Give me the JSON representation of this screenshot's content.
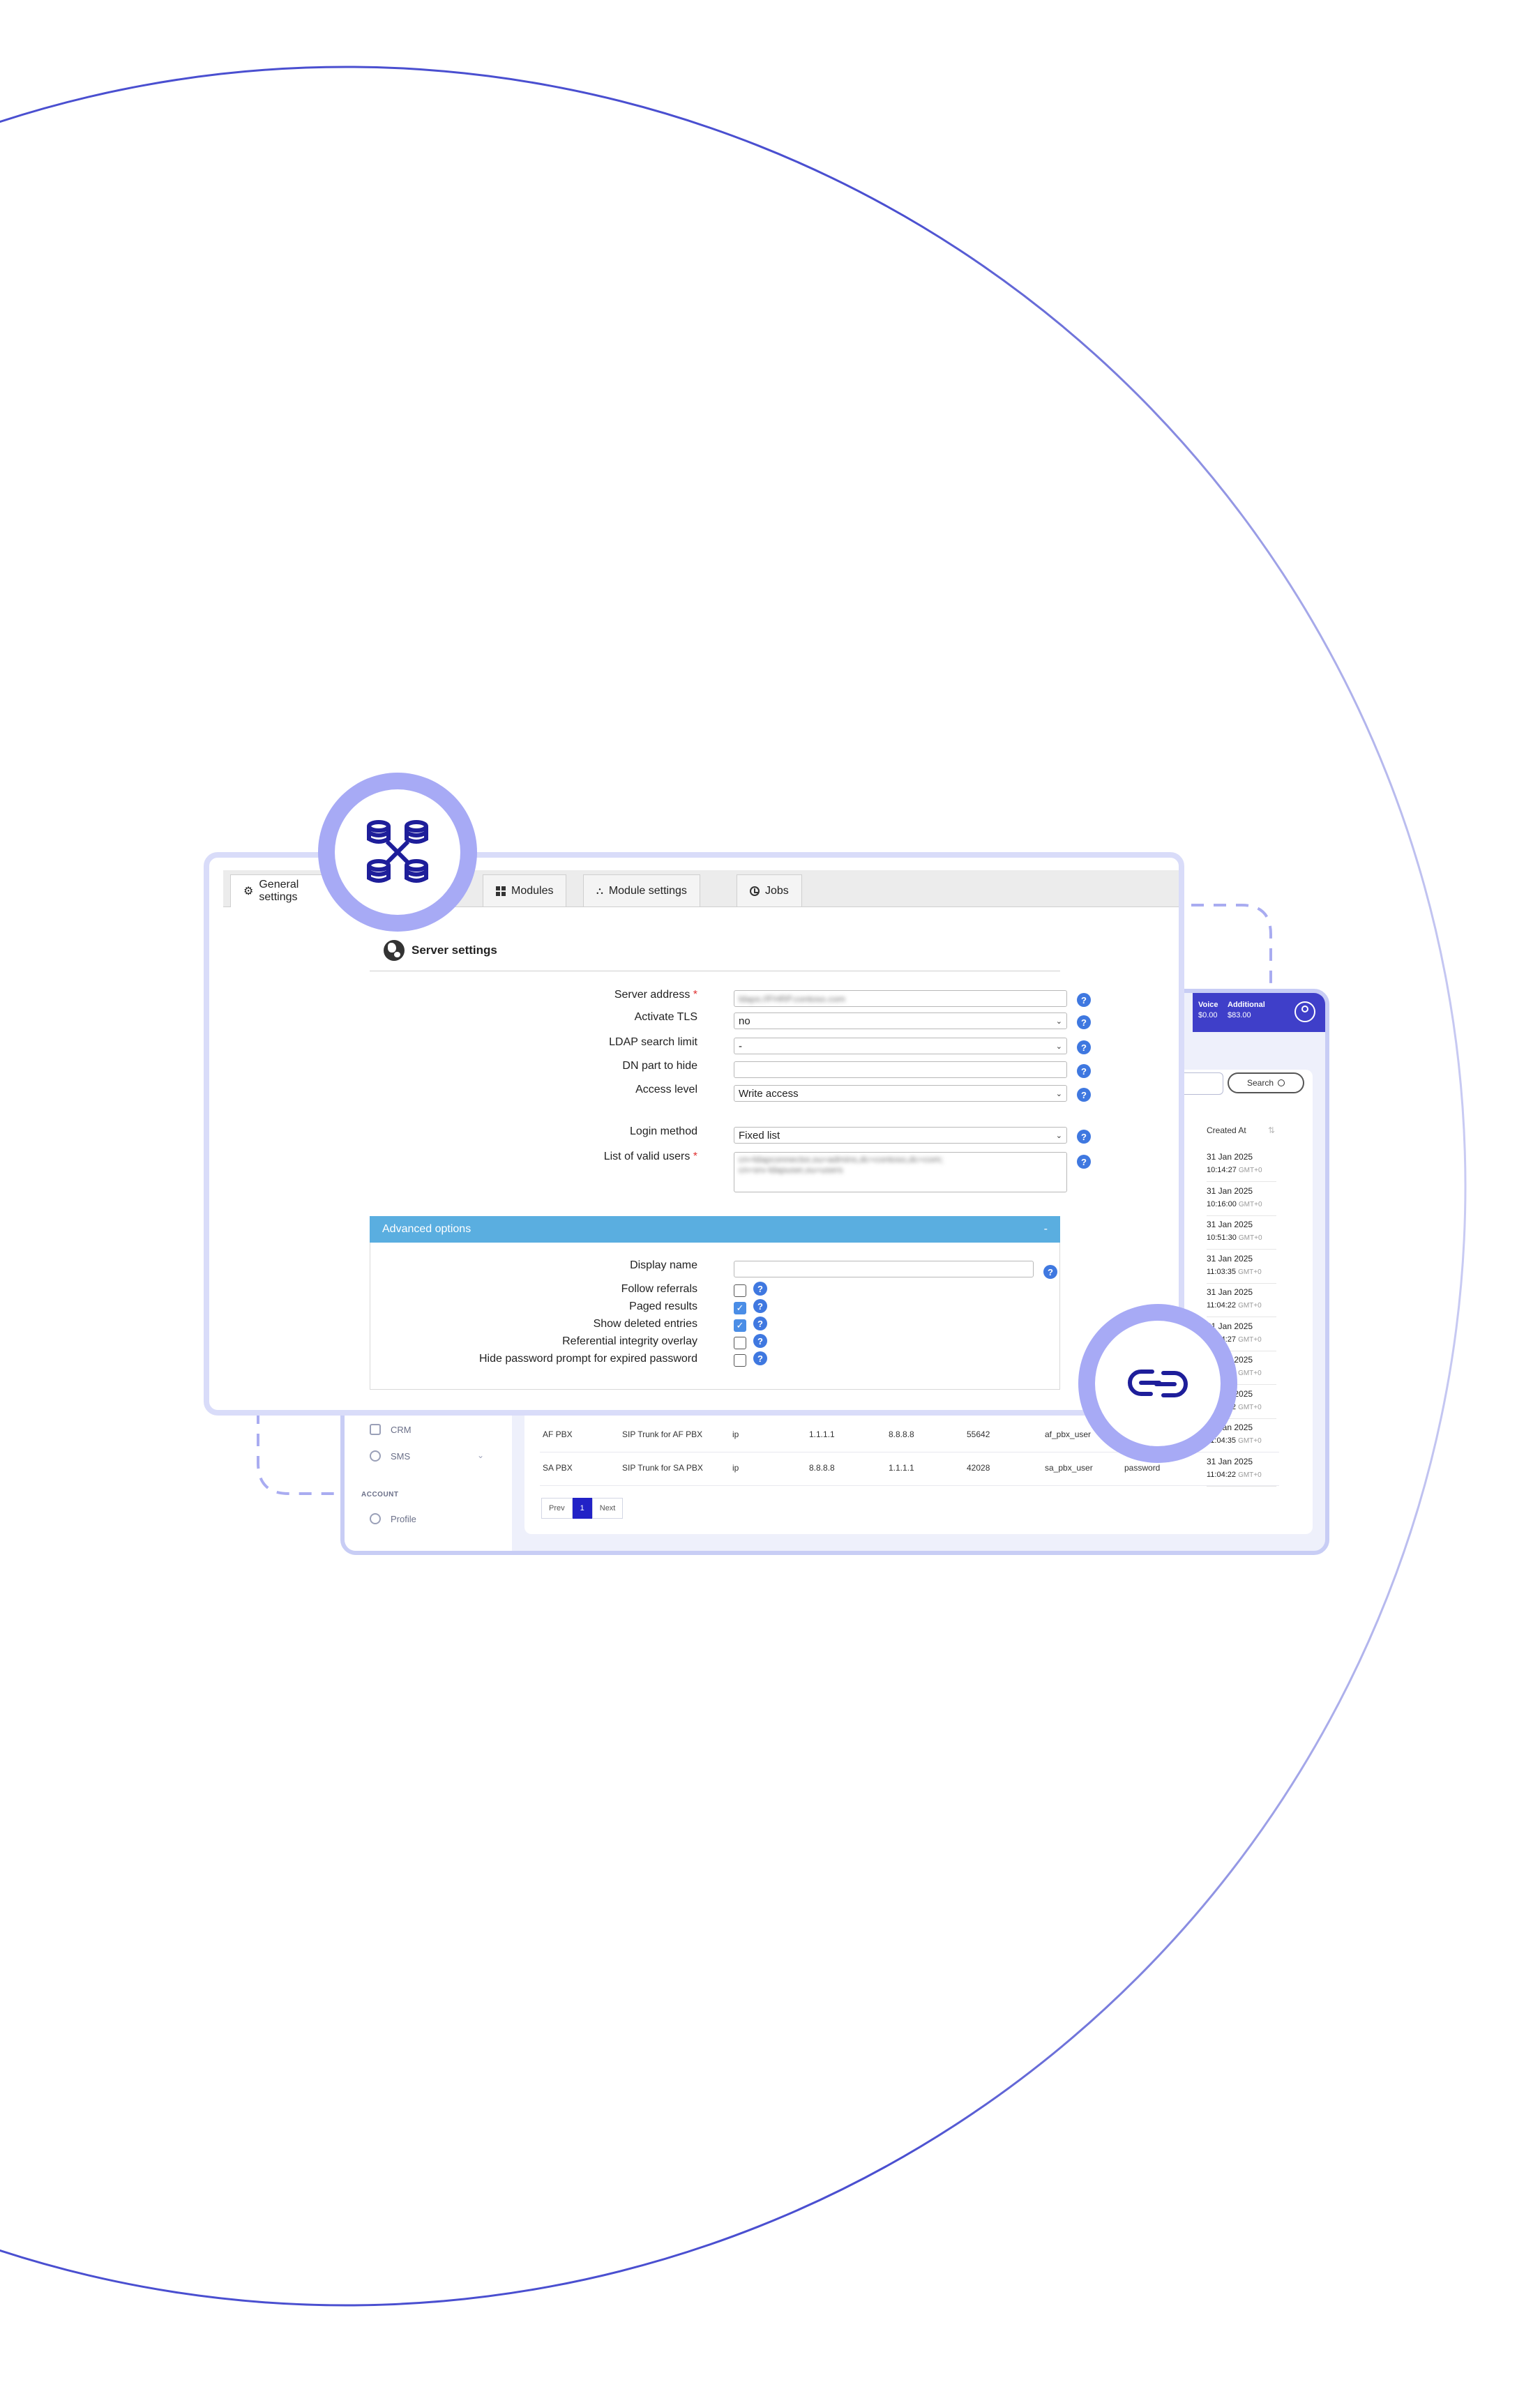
{
  "tabs": [
    {
      "label": "General settings",
      "icon": "gear-icon"
    },
    {
      "label": "",
      "icon": ""
    },
    {
      "label": "Modules",
      "icon": "grid-icon"
    },
    {
      "label": "Module settings",
      "icon": "sitemap-icon"
    },
    {
      "label": "Jobs",
      "icon": "clock-icon"
    }
  ],
  "server_settings": {
    "title": "Server settings",
    "fields": [
      {
        "label": "Server address",
        "required": true,
        "value": "ldaps://FHRP.contoso.com",
        "type": "text-blurred"
      },
      {
        "label": "Activate TLS",
        "required": false,
        "value": "no",
        "type": "select"
      },
      {
        "label": "LDAP search limit",
        "required": false,
        "value": "-",
        "type": "select"
      },
      {
        "label": "DN part to hide",
        "required": false,
        "value": "",
        "type": "text"
      },
      {
        "label": "Access level",
        "required": false,
        "value": "Write access",
        "type": "select"
      },
      {
        "label": "Login method",
        "required": false,
        "value": "Fixed list",
        "type": "select"
      },
      {
        "label": "List of valid users",
        "required": true,
        "value": "cn=ldapconnector,ou=admins,dc=contoso,dc=com;\ncn=srv-ldapuser,ou=users",
        "type": "textarea-blurred"
      }
    ]
  },
  "advanced": {
    "title": "Advanced options",
    "collapse_symbol": "-",
    "display_name_label": "Display name",
    "display_name_value": "",
    "options": [
      {
        "label": "Follow referrals",
        "checked": false
      },
      {
        "label": "Paged results",
        "checked": true
      },
      {
        "label": "Show deleted entries",
        "checked": true
      },
      {
        "label": "Referential integrity overlay",
        "checked": false
      },
      {
        "label": "Hide password prompt for expired password",
        "checked": false
      }
    ]
  },
  "dashboard": {
    "balance_voice_label": "Voice",
    "balance_voice_value": "$0.00",
    "balance_additional_label": "Additional",
    "balance_additional_value": "$83.00",
    "search_label": "Search",
    "created_at_header": "Created At",
    "created_at": [
      {
        "date": "31 Jan 2025",
        "time": "10:14:27",
        "tz": "GMT+0"
      },
      {
        "date": "31 Jan 2025",
        "time": "10:16:00",
        "tz": "GMT+0"
      },
      {
        "date": "31 Jan 2025",
        "time": "10:51:30",
        "tz": "GMT+0"
      },
      {
        "date": "31 Jan 2025",
        "time": "11:03:35",
        "tz": "GMT+0"
      },
      {
        "date": "31 Jan 2025",
        "time": "11:04:22",
        "tz": "GMT+0"
      },
      {
        "date": "31 Jan 2025",
        "time": "11:04:27",
        "tz": "GMT+0"
      },
      {
        "date": "31 Jan 2025",
        "time": "11:04:22",
        "tz": "GMT+0"
      },
      {
        "date": "31 Jan 2025",
        "time": "11:04:22",
        "tz": "GMT+0"
      },
      {
        "date": "31 Jan 2025",
        "time": "11:04:35",
        "tz": "GMT+0"
      },
      {
        "date": "31 Jan 2025",
        "time": "11:04:22",
        "tz": "GMT+0"
      }
    ],
    "rows": [
      {
        "name": "AF PBX",
        "description": "SIP Trunk for AF PBX",
        "type": "ip",
        "ip1": "1.1.1.1",
        "ip2": "8.8.8.8",
        "port": "55642",
        "user": "af_pbx_user",
        "password": ""
      },
      {
        "name": "SA PBX",
        "description": "SIP Trunk for SA PBX",
        "type": "ip",
        "ip1": "8.8.8.8",
        "ip2": "1.1.1.1",
        "port": "42028",
        "user": "sa_pbx_user",
        "password": "password"
      }
    ],
    "sidebar": {
      "crm": "CRM",
      "sms": "SMS",
      "account_header": "ACCOUNT",
      "profile": "Profile"
    },
    "pager": {
      "prev": "Prev",
      "page": "1",
      "next": "Next"
    }
  },
  "colors": {
    "circle_stroke": "#4a4fd0",
    "accent_blue": "#2222c6",
    "badge_ring": "#a7aaf5",
    "advanced_bar": "#5aaee0",
    "help_icon": "#3f78e0"
  }
}
